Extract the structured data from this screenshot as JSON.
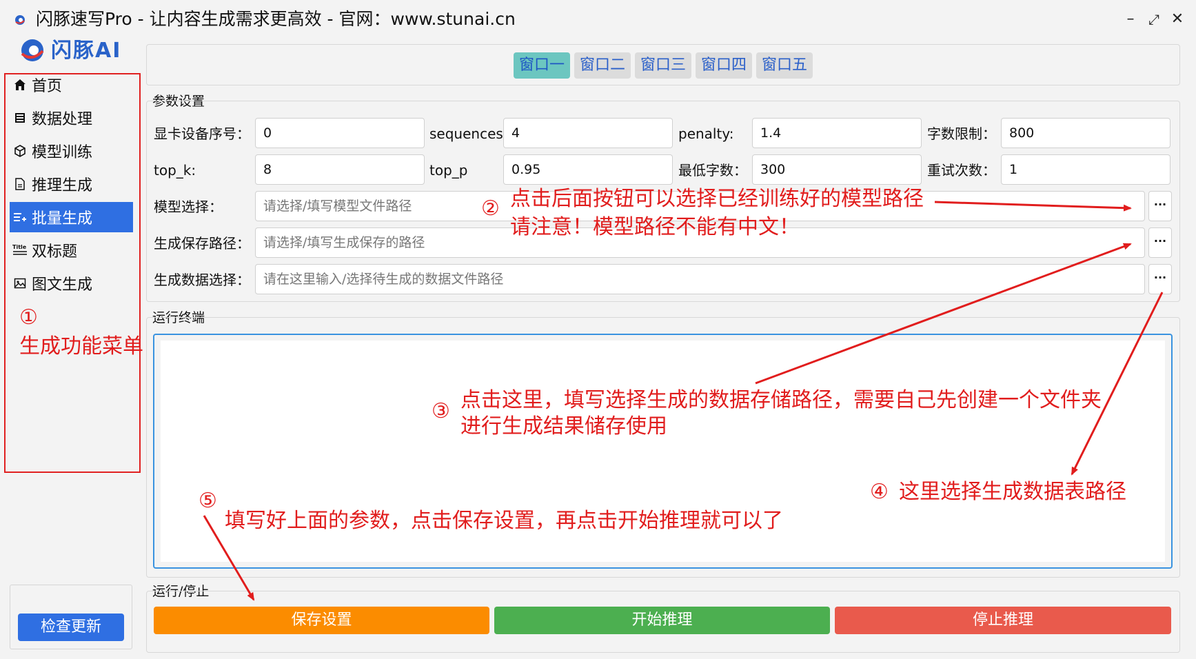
{
  "window": {
    "title": "闪豚速写Pro - 让内容生成需求更高效  -  官网：www.stunai.cn",
    "min_icon": "minimize-icon",
    "max_icon": "maximize-icon",
    "close_icon": "close-icon"
  },
  "logo": {
    "text": "闪豚AI"
  },
  "sidebar": {
    "items": [
      {
        "label": "首页",
        "icon": "home-icon"
      },
      {
        "label": "数据处理",
        "icon": "database-icon"
      },
      {
        "label": "模型训练",
        "icon": "cube-icon"
      },
      {
        "label": "推理生成",
        "icon": "document-icon"
      },
      {
        "label": "批量生成",
        "icon": "list-add-icon",
        "active": true
      },
      {
        "label": "双标题",
        "icon": "title-icon"
      },
      {
        "label": "图文生成",
        "icon": "image-icon"
      }
    ],
    "update_button": "检查更新"
  },
  "tabs": [
    "窗口一",
    "窗口二",
    "窗口三",
    "窗口四",
    "窗口五"
  ],
  "params": {
    "group_label": "参数设置",
    "fields": [
      {
        "label": "显卡设备序号：",
        "value": "0"
      },
      {
        "label": "sequences:",
        "value": "4"
      },
      {
        "label": "penalty:",
        "value": "1.4"
      },
      {
        "label": "字数限制：",
        "value": "800"
      },
      {
        "label": "top_k:",
        "value": "8"
      },
      {
        "label": "top_p",
        "value": "0.95"
      },
      {
        "label": "最低字数：",
        "value": "300"
      },
      {
        "label": "重试次数：",
        "value": "1"
      }
    ],
    "paths": [
      {
        "label": "模型选择：",
        "placeholder": "请选择/填写模型文件路径",
        "button": "···"
      },
      {
        "label": "生成保存路径：",
        "placeholder": "请选择/填写生成保存的路径",
        "button": "···"
      },
      {
        "label": "生成数据选择：",
        "placeholder": "请在这里输入/选择待生成的数据文件路径",
        "button": "···"
      }
    ]
  },
  "terminal": {
    "group_label": "运行终端"
  },
  "run": {
    "group_label": "运行/停止",
    "save_label": "保存设置",
    "start_label": "开始推理",
    "stop_label": "停止推理",
    "colors": {
      "save": "#fb8c00",
      "start": "#4caf50",
      "stop": "#e95a4c"
    }
  },
  "annotations": {
    "a1_num": "①",
    "a1_text": "生成功能菜单",
    "a2_num": "②",
    "a2_line1": "点击后面按钮可以选择已经训练好的模型路径",
    "a2_line2": "请注意！模型路径不能有中文！",
    "a3_num": "③",
    "a3_line1": "点击这里，填写选择生成的数据存储路径，需要自己先创建一个文件夹",
    "a3_line2": "进行生成结果储存使用",
    "a4_num": "④",
    "a4_text": "这里选择生成数据表路径",
    "a5_num": "⑤",
    "a5_text": "填写好上面的参数，点击保存设置，再点击开始推理就可以了",
    "color": "#e11d1d"
  }
}
